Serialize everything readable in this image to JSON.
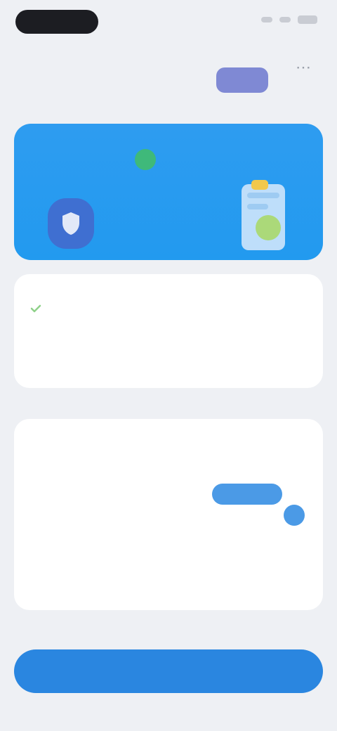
{
  "header": {
    "title": "",
    "badge": ""
  },
  "info": {
    "title": "",
    "description": ""
  },
  "settings": [
    {
      "label": "",
      "sub": ""
    },
    {
      "label": "",
      "sub": ""
    },
    {
      "label": "",
      "sub": ""
    }
  ],
  "primary_button": {
    "label": ""
  },
  "icons": {
    "more": "more-icon",
    "shield": "shield-icon",
    "check": "check-icon"
  },
  "colors": {
    "accent": "#2a86e0",
    "banner": "#229aef",
    "badge": "#7f89d4",
    "green": "#3fb97a"
  }
}
